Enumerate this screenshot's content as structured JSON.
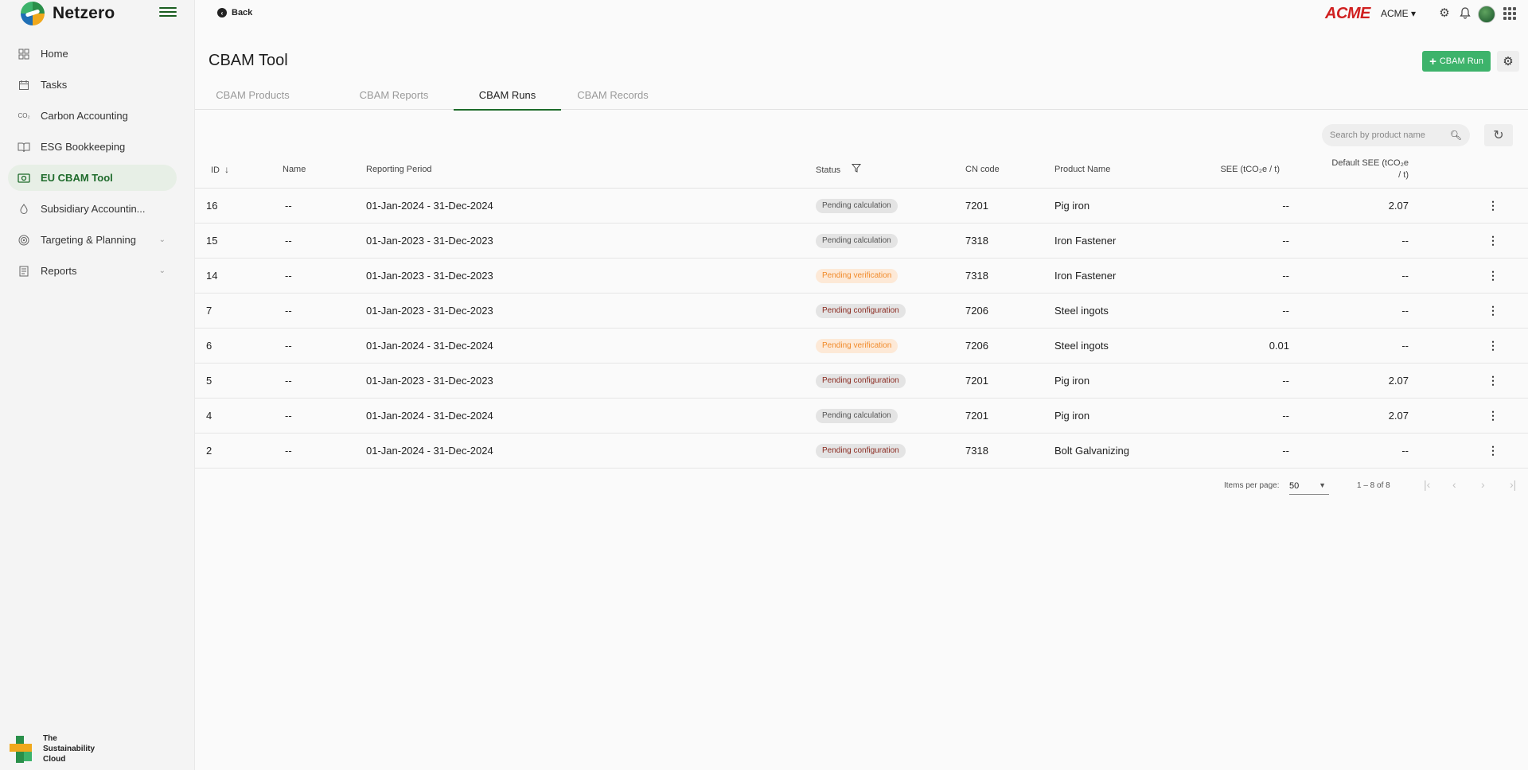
{
  "brand": {
    "name": "Netzero"
  },
  "sidebar": {
    "items": [
      {
        "label": "Home",
        "icon": "home-grid-icon"
      },
      {
        "label": "Tasks",
        "icon": "calendar-icon"
      },
      {
        "label": "Carbon Accounting",
        "icon": "co2-icon",
        "icon_text": "CO₂"
      },
      {
        "label": "ESG Bookkeeping",
        "icon": "book-icon"
      },
      {
        "label": "EU CBAM Tool",
        "icon": "cbam-icon",
        "active": true
      },
      {
        "label": "Subsidiary Accountin...",
        "icon": "drop-icon"
      },
      {
        "label": "Targeting & Planning",
        "icon": "target-icon",
        "expandable": true
      },
      {
        "label": "Reports",
        "icon": "report-icon",
        "expandable": true
      }
    ]
  },
  "footer": {
    "line1": "The",
    "line2": "Sustainability",
    "line3": "Cloud"
  },
  "topbar": {
    "back_label": "Back",
    "company_logo": "ACME",
    "company_menu": "ACME ▾"
  },
  "main": {
    "title": "CBAM Tool",
    "add_button": "CBAM Run",
    "tabs": [
      "CBAM Products",
      "CBAM Reports",
      "CBAM Runs",
      "CBAM Records"
    ],
    "active_tab": "CBAM Runs",
    "search_placeholder": "Search by product name"
  },
  "table": {
    "headers": {
      "id": "ID",
      "name": "Name",
      "period": "Reporting Period",
      "status": "Status",
      "cn": "CN code",
      "product": "Product Name",
      "see": "SEE (tCO₂e / t)",
      "default_see_1": "Default SEE (tCO₂e",
      "default_see_2": "/ t)"
    },
    "rows": [
      {
        "id": "16",
        "name": "--",
        "period": "01-Jan-2024 - 31-Dec-2024",
        "status": "Pending calculation",
        "cn": "7201",
        "product": "Pig iron",
        "see": "--",
        "default_see": "2.07"
      },
      {
        "id": "15",
        "name": "--",
        "period": "01-Jan-2023 - 31-Dec-2023",
        "status": "Pending calculation",
        "cn": "7318",
        "product": "Iron Fastener",
        "see": "--",
        "default_see": "--"
      },
      {
        "id": "14",
        "name": "--",
        "period": "01-Jan-2023 - 31-Dec-2023",
        "status": "Pending verification",
        "cn": "7318",
        "product": "Iron Fastener",
        "see": "--",
        "default_see": "--"
      },
      {
        "id": "7",
        "name": "--",
        "period": "01-Jan-2023 - 31-Dec-2023",
        "status": "Pending configuration",
        "cn": "7206",
        "product": "Steel ingots",
        "see": "--",
        "default_see": "--"
      },
      {
        "id": "6",
        "name": "--",
        "period": "01-Jan-2024 - 31-Dec-2024",
        "status": "Pending verification",
        "cn": "7206",
        "product": "Steel ingots",
        "see": "0.01",
        "default_see": "--"
      },
      {
        "id": "5",
        "name": "--",
        "period": "01-Jan-2023 - 31-Dec-2023",
        "status": "Pending configuration",
        "cn": "7201",
        "product": "Pig iron",
        "see": "--",
        "default_see": "2.07"
      },
      {
        "id": "4",
        "name": "--",
        "period": "01-Jan-2024 - 31-Dec-2024",
        "status": "Pending calculation",
        "cn": "7201",
        "product": "Pig iron",
        "see": "--",
        "default_see": "2.07"
      },
      {
        "id": "2",
        "name": "--",
        "period": "01-Jan-2024 - 31-Dec-2024",
        "status": "Pending configuration",
        "cn": "7318",
        "product": "Bolt Galvanizing",
        "see": "--",
        "default_see": "--"
      }
    ]
  },
  "pager": {
    "items_per_page_label": "Items per page:",
    "page_size": "50",
    "range": "1 – 8 of 8"
  },
  "colors": {
    "accent_green": "#3db36b",
    "active_nav": "#1e6b2b",
    "acme_red": "#d02020",
    "verification_orange": "#f08a2a",
    "configuration_red": "#8b2a20"
  }
}
